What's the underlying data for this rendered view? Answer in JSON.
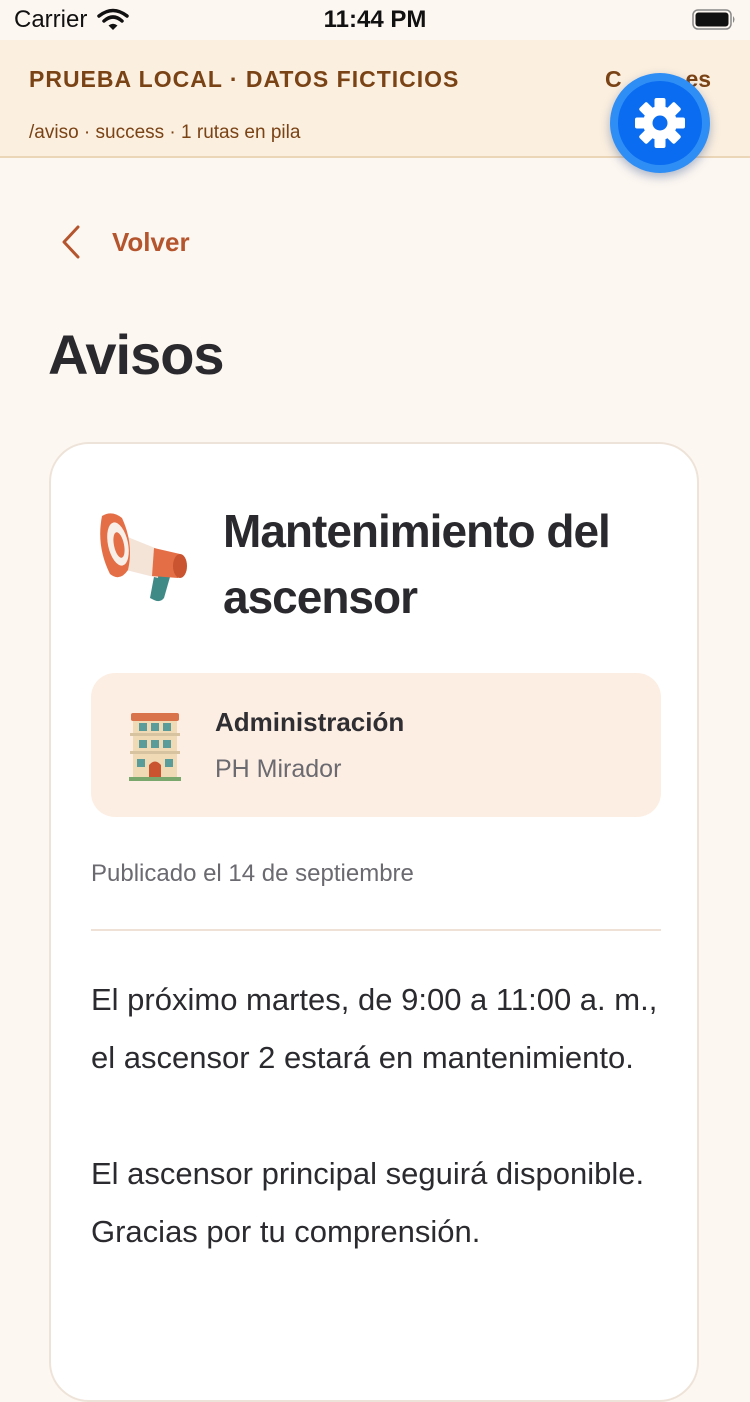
{
  "status_bar": {
    "carrier": "Carrier",
    "time": "11:44 PM"
  },
  "debug_banner": {
    "title": "PRUEBA LOCAL · DATOS FICTICIOS",
    "right_partial": "C          es",
    "subtitle": "/aviso · success · 1 rutas en pila"
  },
  "back": {
    "label": "Volver"
  },
  "page": {
    "title": "Avisos"
  },
  "notice": {
    "title": "Mantenimiento del ascensor",
    "publisher": {
      "name": "Administración",
      "org": "PH Mirador"
    },
    "published": "Publicado el 14 de septiembre",
    "paragraphs": [
      "El próximo martes, de 9:00 a 11:00 a. m., el ascensor 2 estará en mantenimiento.",
      "El ascensor principal seguirá disponible. Gracias por tu comprensión."
    ]
  },
  "icons": {
    "wifi": "wifi-icon",
    "battery": "battery-icon",
    "settings": "gear-icon",
    "back": "chevron-left-icon",
    "notice": "megaphone-icon",
    "publisher": "building-icon"
  },
  "colors": {
    "accent": "#b4552e",
    "fab": "#0a6cf0",
    "banner_bg": "#fbefdf",
    "banner_text": "#7a4316",
    "publisher_bg": "#fdeee3"
  }
}
